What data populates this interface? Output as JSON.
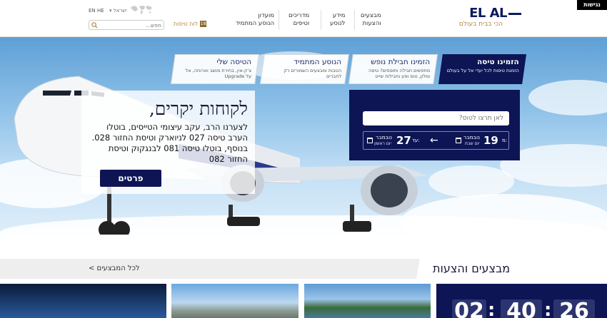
{
  "header": {
    "accessibility_label": "נגישות",
    "logo": {
      "brand_text": "EL AL",
      "tagline": "הכי בבית בעולם"
    },
    "nav": [
      {
        "line1": "מבצעים",
        "line2": "והצעות"
      },
      {
        "line1": "מידע",
        "line2": "לנוסע"
      },
      {
        "line1": "מדריכים",
        "line2": "וטיפים"
      },
      {
        "line1": "מועדון",
        "line2": "הנוסע המתמיד"
      }
    ],
    "lang_en": "EN",
    "lang_he": "HE",
    "country": "ישראל",
    "search_placeholder": "חפש...",
    "flights_board": "לוח טיסות",
    "flights_board_icon": "18"
  },
  "hero": {
    "tabs": [
      {
        "title": "הזמינו טיסה",
        "desc": "הזמנת טיסות לכל יעדי אל על בעולם",
        "active": true
      },
      {
        "title": "הזמינו חבילת נופש",
        "desc": "מחפשים חבילה ותוספים? טיסה ומלון, טוס וסע וחבילות שייט",
        "active": false
      },
      {
        "title": "הנוסע המתמיד",
        "desc": "הטבות ומבצעים השמורים רק לחברים",
        "active": false
      },
      {
        "title": "הטיסה שלי",
        "desc": "צ'ק-אין, בחירת מושב וארוחה, אל על Upgrade",
        "active": false
      }
    ],
    "booking": {
      "destination_placeholder": "לאן תרצו לטוס?",
      "from_label": "מ:",
      "from_day": "19",
      "from_month": "נובמבר",
      "from_weekday": "יום שבת",
      "to_label": "עד:",
      "to_day": "27",
      "to_month": "נובמבר",
      "to_weekday": "יום ראשון"
    },
    "promo": {
      "title": "לקוחות יקרים,",
      "text": "לצערנו הרב, עקב עיצומי הטייסים, בוטלו הערב טיסה 027 לניוארק וטיסת החזור 028. בנוסף, בוטלו טיסה 081 לבנגקוק וטיסת החזור 082",
      "button": "פרטים"
    },
    "slider_prev": "‹",
    "slider_next": "›"
  },
  "deals": {
    "title": "מבצעים והצעות",
    "all_link": "לכל המבצעים >",
    "countdown": [
      "0",
      "2",
      "4",
      "0",
      "2",
      "6"
    ]
  },
  "colors": {
    "brand_navy": "#0d1555",
    "gold": "#b08a3c"
  }
}
